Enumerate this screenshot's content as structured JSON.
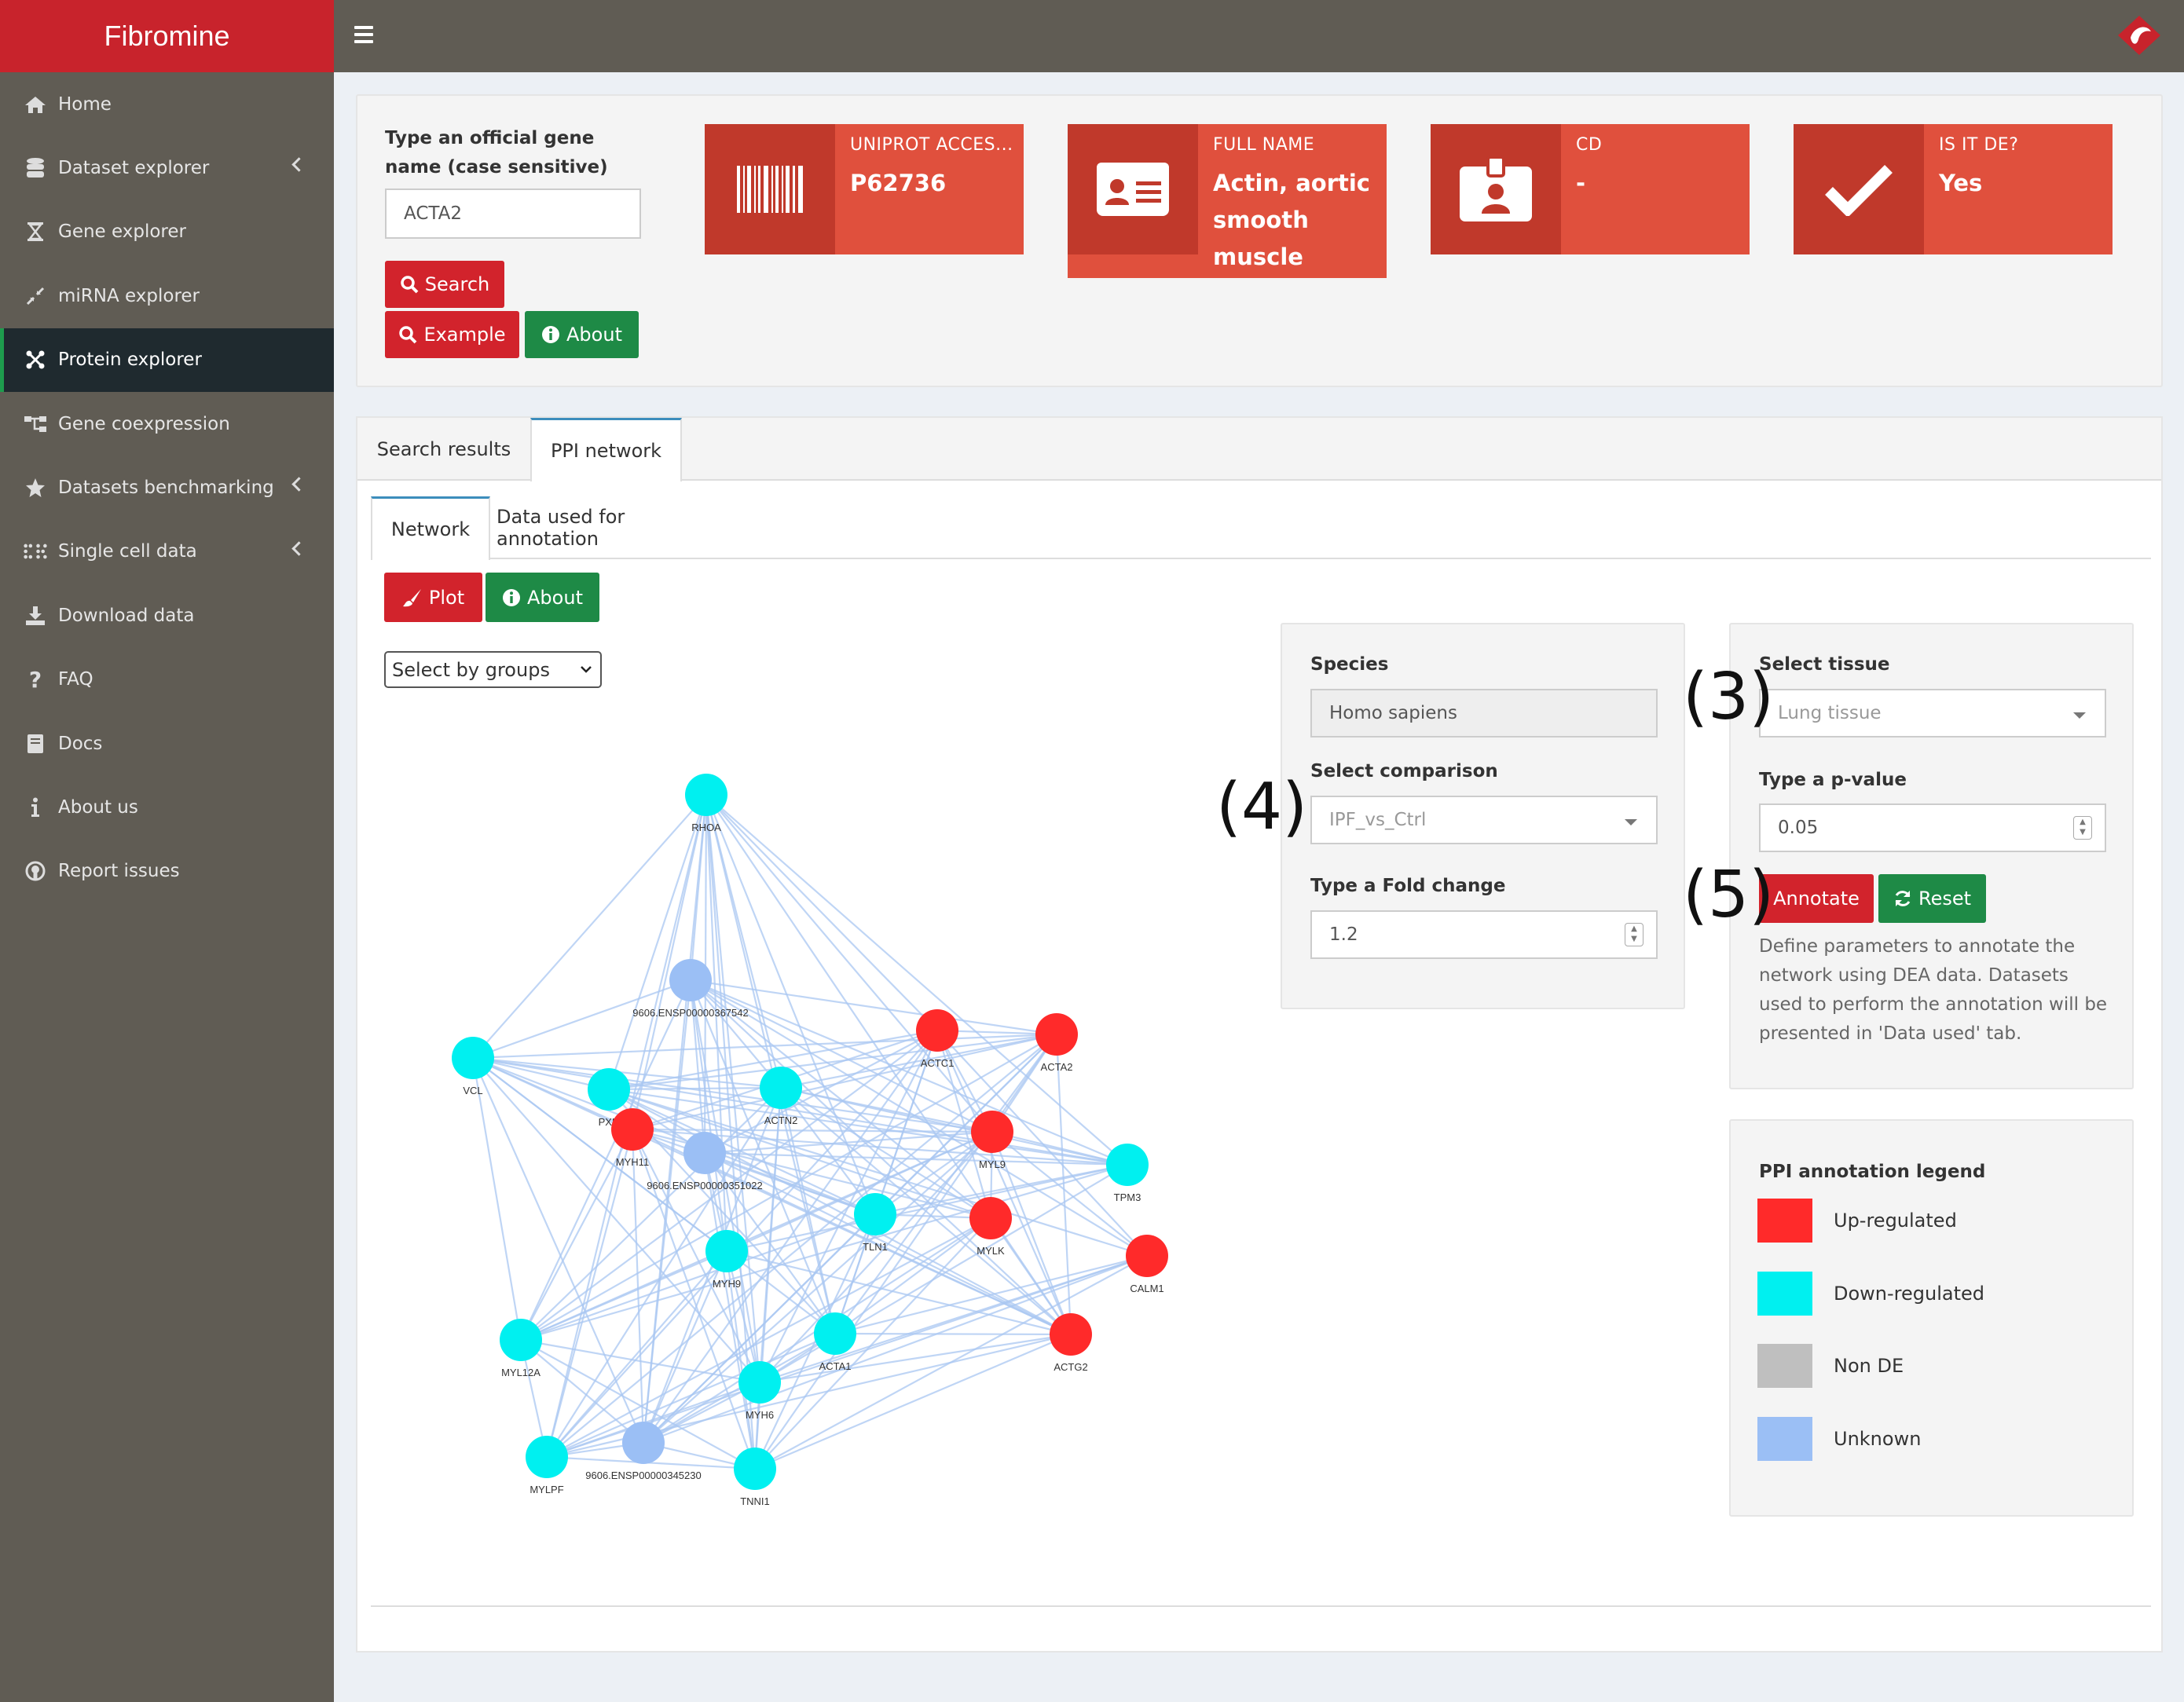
{
  "app": {
    "brand": "Fibromine"
  },
  "sidebar": {
    "items": [
      {
        "label": "Home",
        "icon": "home-icon"
      },
      {
        "label": "Dataset explorer",
        "icon": "database-icon"
      },
      {
        "label": "Gene explorer",
        "icon": "hourglass-icon"
      },
      {
        "label": "miRNA explorer",
        "icon": "compress-icon"
      },
      {
        "label": "Protein explorer",
        "icon": "network-icon",
        "active": true
      },
      {
        "label": "Gene coexpression",
        "icon": "sitemap-icon"
      },
      {
        "label": "Datasets benchmarking",
        "icon": "star-icon"
      },
      {
        "label": "Single cell data",
        "icon": "dots-grid-icon"
      },
      {
        "label": "Download data",
        "icon": "download-icon"
      },
      {
        "label": "FAQ",
        "icon": "question-icon"
      },
      {
        "label": "Docs",
        "icon": "book-icon"
      },
      {
        "label": "About us",
        "icon": "info-icon"
      },
      {
        "label": "Report issues",
        "icon": "github-icon"
      }
    ]
  },
  "search": {
    "label": "Type an official gene name (case sensitive)",
    "value": "ACTA2",
    "search_btn": "Search",
    "example_btn": "Example",
    "about_btn": "About"
  },
  "info_boxes": [
    {
      "title": "UNIPROT ACCES...",
      "value": "P62736",
      "icon": "barcode-icon"
    },
    {
      "title": "FULL NAME",
      "value": "Actin, aortic smooth muscle",
      "icon": "id-card-icon"
    },
    {
      "title": "CD",
      "value": "-",
      "icon": "id-badge-icon"
    },
    {
      "title": "IS IT DE?",
      "value": "Yes",
      "icon": "check-icon"
    }
  ],
  "tabs": {
    "main": [
      "Search results",
      "PPI network"
    ],
    "sub": [
      "Network",
      "Data used for annotation"
    ]
  },
  "controls": {
    "plot_btn": "Plot",
    "about_btn": "About",
    "select_groups": "Select by groups",
    "species_label": "Species",
    "species_value": "Homo sapiens",
    "comparison_label": "Select comparison",
    "comparison_value": "IPF_vs_Ctrl",
    "fold_label": "Type a Fold change",
    "fold_value": "1.2",
    "tissue_label": "Select tissue",
    "tissue_value": "Lung tissue",
    "pvalue_label": "Type a p-value",
    "pvalue_value": "0.05",
    "annotate_btn": "Annotate",
    "reset_btn": "Reset",
    "help_text": "Define parameters to annotate the network using DEA data. Datasets used to perform the annotation will be presented in 'Data used' tab."
  },
  "callouts": [
    "(3)",
    "(4)",
    "(5)"
  ],
  "legend": {
    "title": "PPI annotation legend",
    "items": [
      {
        "label": "Up-regulated",
        "color": "#ff2a2a"
      },
      {
        "label": "Down-regulated",
        "color": "#00f0f0"
      },
      {
        "label": "Non DE",
        "color": "#bfbfbf"
      },
      {
        "label": "Unknown",
        "color": "#9bbff5"
      }
    ]
  },
  "network": {
    "nodes": [
      {
        "id": "RHOA",
        "status": "down"
      },
      {
        "id": "9606.ENSP00000367542",
        "status": "unknown"
      },
      {
        "id": "VCL",
        "status": "down"
      },
      {
        "id": "PXN",
        "status": "down"
      },
      {
        "id": "MYH11",
        "status": "up"
      },
      {
        "id": "9606.ENSP00000351022",
        "status": "unknown"
      },
      {
        "id": "ACTN2",
        "status": "down"
      },
      {
        "id": "ACTC1",
        "status": "up"
      },
      {
        "id": "ACTA2",
        "status": "up"
      },
      {
        "id": "MYL9",
        "status": "up"
      },
      {
        "id": "TPM3",
        "status": "down"
      },
      {
        "id": "TLN1",
        "status": "down"
      },
      {
        "id": "MYLK",
        "status": "up"
      },
      {
        "id": "CALM1",
        "status": "up"
      },
      {
        "id": "MYH9",
        "status": "down"
      },
      {
        "id": "ACTG2",
        "status": "up"
      },
      {
        "id": "ACTA1",
        "status": "down"
      },
      {
        "id": "MYL12A",
        "status": "down"
      },
      {
        "id": "MYH6",
        "status": "down"
      },
      {
        "id": "9606.ENSP00000345230",
        "status": "unknown"
      },
      {
        "id": "MYLPF",
        "status": "down"
      },
      {
        "id": "TNNI1",
        "status": "down"
      }
    ]
  }
}
